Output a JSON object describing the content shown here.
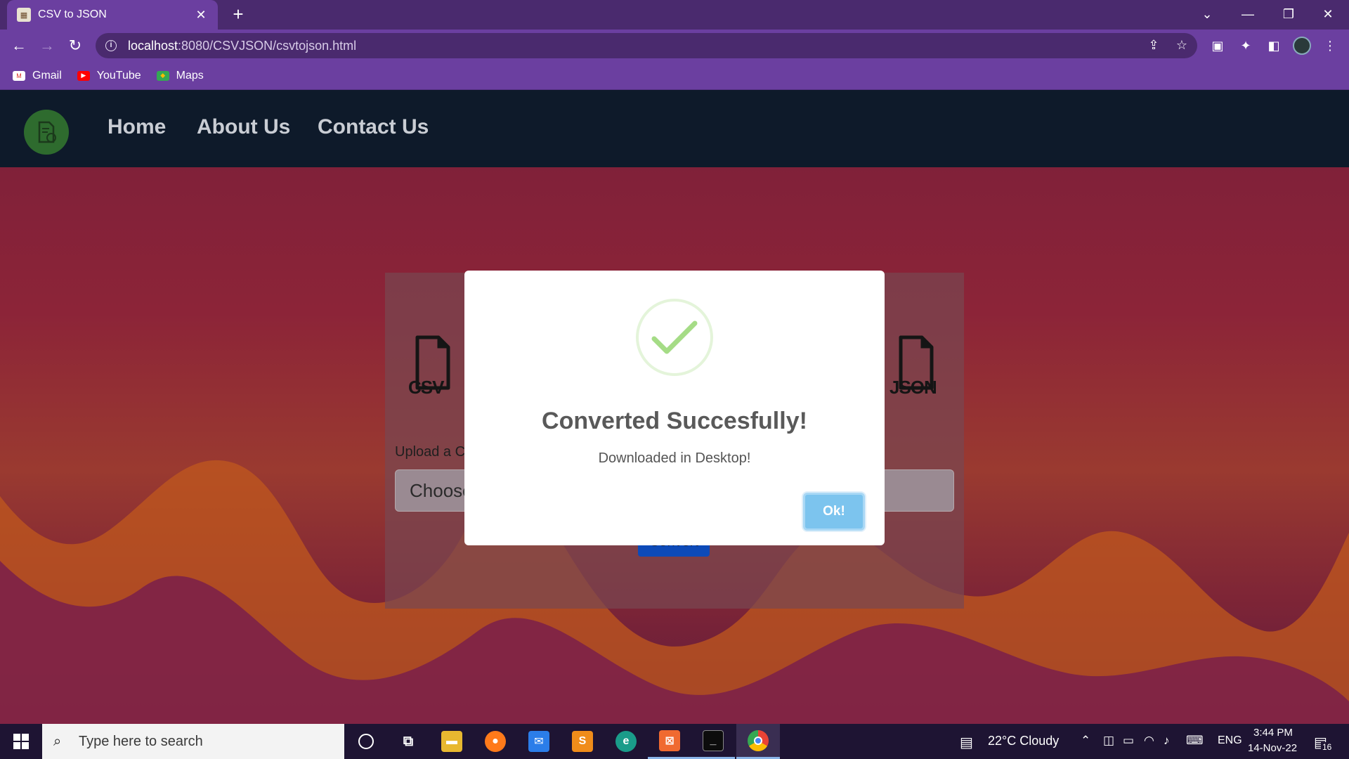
{
  "browser": {
    "tab": {
      "title": "CSV to JSON",
      "close": "✕"
    },
    "new_tab": "+",
    "url_host": "localhost",
    "url_rest": ":8080/CSVJSON/csvtojson.html",
    "bookmarks": [
      {
        "label": "Gmail",
        "icon": "gmail-icon"
      },
      {
        "label": "YouTube",
        "icon": "youtube-icon"
      },
      {
        "label": "Maps",
        "icon": "maps-icon"
      }
    ]
  },
  "site": {
    "nav": [
      "Home",
      "About Us",
      "Contact Us"
    ],
    "card": {
      "csv_label": "CSV",
      "json_label": "JSON",
      "upload_label": "Upload a C",
      "file_input": "Choose",
      "convert": "Convert"
    }
  },
  "modal": {
    "title": "Converted Succesfully!",
    "text": "Downloaded in Desktop!",
    "ok": "Ok!"
  },
  "taskbar": {
    "search_placeholder": "Type here to search",
    "weather": "22°C  Cloudy",
    "lang": "ENG",
    "time": "3:44 PM",
    "date": "14-Nov-22",
    "notifications": "16"
  },
  "colors": {
    "accent": "#6b3fa0",
    "nav_bg": "#0e1a2a",
    "ok_button": "#7cc4ee",
    "success_check": "#a5dc86"
  }
}
